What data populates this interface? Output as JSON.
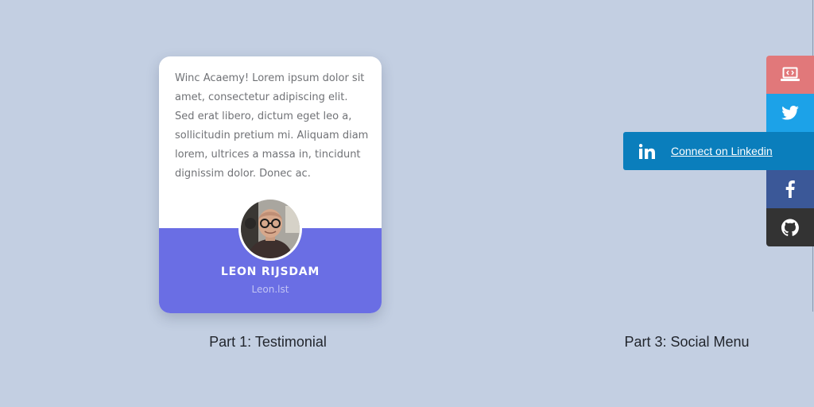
{
  "testimonial": {
    "quote": "Winc Acaemy! Lorem ipsum dolor sit amet, consectetur adipiscing elit. Sed erat libero, dictum eget leo a, sollicitudin pretium mi. Aliquam diam lorem, ultrices a massa in, tincidunt dignissim dolor. Donec ac.",
    "author_name": "LEON RIJSDAM",
    "author_site": "Leon.lst",
    "avatar_icon": "user-photo"
  },
  "captions": {
    "part1": "Part 1: Testimonial",
    "part3": "Part 3: Social Menu"
  },
  "social_menu": {
    "items": [
      {
        "icon": "laptop-code-icon",
        "color": "#e1787a"
      },
      {
        "icon": "twitter-icon",
        "color": "#1ca2e8"
      },
      {
        "icon": "linkedin-icon",
        "color": "#0a7ebc",
        "label": "Connect on Linkedin"
      },
      {
        "icon": "facebook-icon",
        "color": "#3b5898"
      },
      {
        "icon": "github-icon",
        "color": "#333333"
      }
    ]
  },
  "colors": {
    "background": "#c3cfe2",
    "card_footer": "#6a6ee4"
  }
}
